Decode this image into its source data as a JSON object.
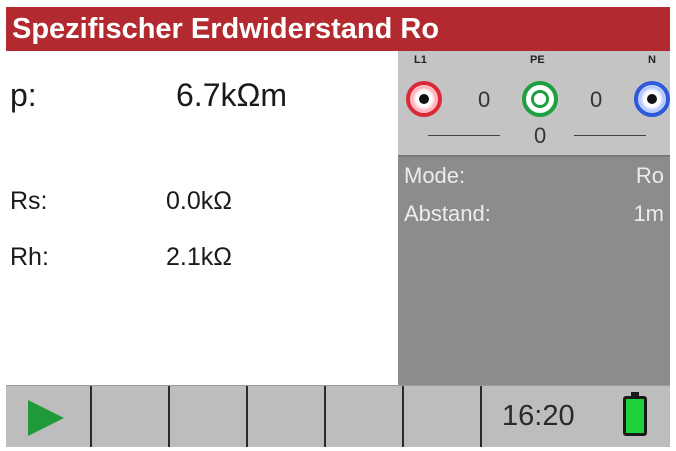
{
  "title": "Spezifischer Erdwiderstand Ro",
  "measurements": {
    "rho": {
      "label": "p:",
      "value": "6.7kΩm"
    },
    "rs": {
      "label": "Rs:",
      "value": "0.0kΩ"
    },
    "rh": {
      "label": "Rh:",
      "value": "2.1kΩ"
    }
  },
  "terminals": {
    "l1": {
      "label": "L1",
      "color": "#d92a3a"
    },
    "pe": {
      "label": "PE",
      "color": "#1fa040"
    },
    "n": {
      "label": "N",
      "color": "#2d5ad8"
    },
    "l1_pe_value": "0",
    "pe_n_value": "0",
    "l1_n_value": "0"
  },
  "info": {
    "mode_label": "Mode:",
    "mode_value": "Ro",
    "abstand_label": "Abstand:",
    "abstand_value": "1m"
  },
  "footer": {
    "play_icon": "play-icon",
    "time": "16:20",
    "battery_icon": "battery-full-icon"
  },
  "colors": {
    "title_bar": "#b22a2f",
    "info_panel": "#8c8c8c",
    "terminal_panel": "#c4c4c4",
    "footer": "#bdbdbd",
    "play": "#1f9a3a",
    "battery": "#1fd13a"
  }
}
